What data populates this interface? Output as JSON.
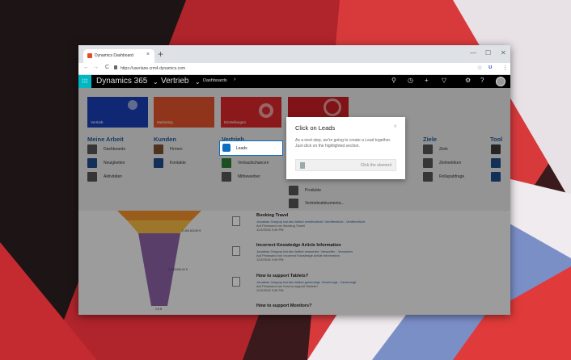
{
  "browser": {
    "tab_title": "Dynamics Dashboard",
    "tab_close": "×",
    "new_tab": "+",
    "url": "https://userlane.crm4.dynamics.com",
    "back": "←",
    "forward": "→",
    "reload": "C",
    "minimize": "—",
    "maximize": "☐",
    "close": "✕",
    "star": "☆",
    "menu": "⋮"
  },
  "dynamics": {
    "app_name": "Dynamics 365",
    "area": "Vertrieb",
    "breadcrumb": "Dashboards",
    "breadcrumb_chevron": "›",
    "chevron": "⌄",
    "icons": [
      "search-icon",
      "history-icon",
      "plus-icon",
      "filter-icon",
      "settings-icon",
      "help-icon"
    ]
  },
  "tiles": [
    {
      "label": "Vertrieb",
      "color": "#1a3fb5"
    },
    {
      "label": "Marketing",
      "color": "#e2542c"
    },
    {
      "label": "Einstellungen",
      "color": "#d9282d"
    },
    {
      "label": "",
      "color": "#c81f24"
    }
  ],
  "columns": {
    "meine_arbeit": {
      "title": "Meine Arbeit",
      "items": [
        "Dashboards",
        "Neuigkeiten",
        "Aktivitäten"
      ]
    },
    "kunden": {
      "title": "Kunden",
      "items": [
        "Firmen",
        "Kontakte"
      ]
    },
    "vertrieb": {
      "title": "Vertrieb",
      "items": [
        "Leads",
        "Verkaufschancen",
        "Mitbewerber"
      ]
    },
    "collateral": {
      "items": [
        "Produkte",
        "Vertriebsdokumenta..."
      ]
    },
    "ziele": {
      "title": "Ziele",
      "items": [
        "Ziele",
        "Zielmetriken",
        "Rollupabfrage"
      ]
    },
    "tool": {
      "title": "Tool"
    }
  },
  "popup": {
    "title": "Click on Leads",
    "close": "×",
    "description": "As a next step, we're going to create a Lead together. Just click on the highlighted section.",
    "button": "Click the element"
  },
  "funnel": {
    "labels": [
      "2,465,543,80 €",
      "11,428,560,00 €",
      "2,8 B"
    ]
  },
  "posts": [
    {
      "title": "Booking Travel",
      "line1": "Jonathan Gregory hat den Artikel veröffentlicht: Veröffentlicht - Veröffentlicht",
      "line2": "Auf Pinnwand von Booking Travel",
      "line3": "11/3/2018 3:49 PM"
    },
    {
      "title": "Incorrect Knowledge Article Information",
      "line1": "Jonathan Gregory hat den Artikel verworfen: Verworfen - Verworfen",
      "line2": "Auf Pinnwand von Incorrect Knowledge Article Information",
      "line3": "11/3/2018 3:49 PM"
    },
    {
      "title": "How to support Tablets?",
      "line1": "Jonathan Gregory hat den Artikel genehmigt: Genehmigt - Genehmigt",
      "line2": "Auf Pinnwand von How to support Tablets?",
      "line3": "11/3/2018 3:49 PM"
    },
    {
      "title": "How to support Monitors?"
    }
  ]
}
